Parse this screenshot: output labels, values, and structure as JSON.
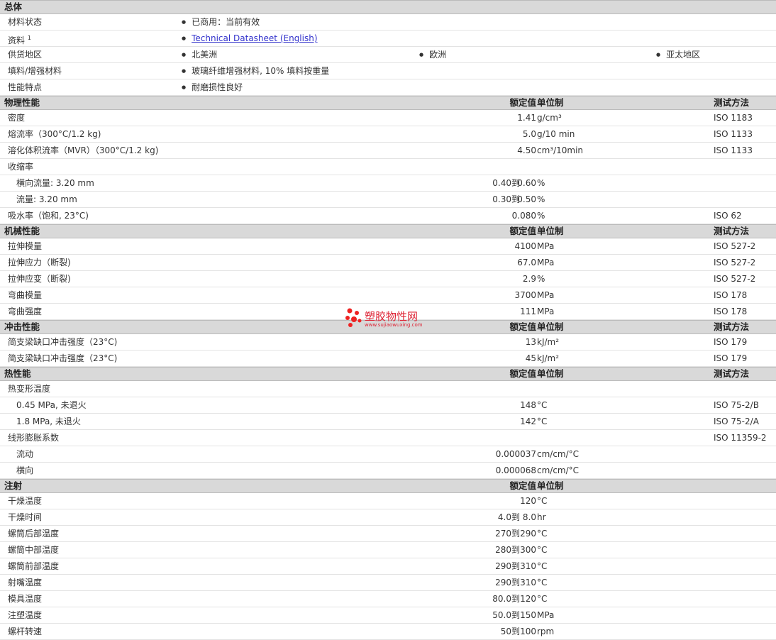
{
  "general": {
    "title": "总体",
    "rows": [
      {
        "label": "材料状态",
        "values": [
          "已商用：当前有效"
        ]
      },
      {
        "label": "资料",
        "sup": "1",
        "link": "Technical Datasheet (English)"
      },
      {
        "label": "供货地区",
        "values": [
          "北美洲",
          "欧洲",
          "亚太地区"
        ]
      },
      {
        "label": "填料/增强材料",
        "values": [
          "玻璃纤维增强材料, 10% 填料按重量"
        ]
      },
      {
        "label": "性能特点",
        "values": [
          "耐磨损性良好"
        ]
      }
    ]
  },
  "headers": {
    "nominal": "额定值",
    "unit": "单位制",
    "test": "测试方法",
    "to": "到"
  },
  "sections": [
    {
      "title": "物理性能",
      "has_test": true,
      "rows": [
        {
          "label": "密度",
          "value": "1.41",
          "unit": "g/cm³",
          "test": "ISO 1183"
        },
        {
          "label": "熔流率（300°C/1.2 kg)",
          "value": "5.0",
          "unit": "g/10 min",
          "test": "ISO 1133"
        },
        {
          "label": "溶化体积流率（MVR）（300°C/1.2 kg)",
          "value": "4.50",
          "unit": "cm³/10min",
          "test": "ISO 1133"
        },
        {
          "label": "收缩率"
        },
        {
          "label": "横向流量: 3.20 mm",
          "sub": true,
          "v1": "0.40",
          "v2": "0.60",
          "unit": "%"
        },
        {
          "label": "流量: 3.20 mm",
          "sub": true,
          "v1": "0.30",
          "v2": "0.50",
          "unit": "%"
        },
        {
          "label": "吸水率（饱和, 23°C)",
          "value": "0.080",
          "unit": "%",
          "test": "ISO 62"
        }
      ]
    },
    {
      "title": "机械性能",
      "has_test": true,
      "rows": [
        {
          "label": "拉伸模量",
          "value": "4100",
          "unit": "MPa",
          "test": "ISO 527-2"
        },
        {
          "label": "拉伸应力（断裂)",
          "value": "67.0",
          "unit": "MPa",
          "test": "ISO 527-2"
        },
        {
          "label": "拉伸应变（断裂)",
          "value": "2.9",
          "unit": "%",
          "test": "ISO 527-2"
        },
        {
          "label": "弯曲模量",
          "value": "3700",
          "unit": "MPa",
          "test": "ISO 178"
        },
        {
          "label": "弯曲强度",
          "value": "111",
          "unit": "MPa",
          "test": "ISO 178"
        }
      ]
    },
    {
      "title": "冲击性能",
      "has_test": true,
      "rows": [
        {
          "label": "简支梁缺口冲击强度（23°C)",
          "value": "13",
          "unit": "kJ/m²",
          "test": "ISO 179"
        },
        {
          "label": "简支梁缺口冲击强度（23°C)",
          "value": "45",
          "unit": "kJ/m²",
          "test": "ISO 179"
        }
      ]
    },
    {
      "title": "热性能",
      "has_test": true,
      "rows": [
        {
          "label": "热变形温度"
        },
        {
          "label": "0.45 MPa, 未退火",
          "sub": true,
          "value": "148",
          "unit": "°C",
          "test": "ISO 75-2/B"
        },
        {
          "label": "1.8 MPa, 未退火",
          "sub": true,
          "value": "142",
          "unit": "°C",
          "test": "ISO 75-2/A"
        },
        {
          "label": "线形膨胀系数",
          "test": "ISO 11359-2"
        },
        {
          "label": "流动",
          "sub": true,
          "value": "0.000037",
          "unit": "cm/cm/°C"
        },
        {
          "label": "横向",
          "sub": true,
          "value": "0.000068",
          "unit": "cm/cm/°C"
        }
      ]
    },
    {
      "title": "注射",
      "has_test": false,
      "rows": [
        {
          "label": "干燥温度",
          "value": "120",
          "unit": "°C"
        },
        {
          "label": "干燥时间",
          "v1": "4.0",
          "v2": "8.0",
          "unit": "hr"
        },
        {
          "label": "螺筒后部温度",
          "v1": "270",
          "v2": "290",
          "unit": "°C"
        },
        {
          "label": "螺筒中部温度",
          "v1": "280",
          "v2": "300",
          "unit": "°C"
        },
        {
          "label": "螺筒前部温度",
          "v1": "290",
          "v2": "310",
          "unit": "°C"
        },
        {
          "label": "射嘴温度",
          "v1": "290",
          "v2": "310",
          "unit": "°C"
        },
        {
          "label": "模具温度",
          "v1": "80.0",
          "v2": "120",
          "unit": "°C"
        },
        {
          "label": "注塑温度",
          "v1": "50.0",
          "v2": "150",
          "unit": "MPa"
        },
        {
          "label": "螺杆转速",
          "v1": "50",
          "v2": "100",
          "unit": "rpm"
        }
      ]
    }
  ],
  "watermark": {
    "title": "塑胶物性网",
    "url": "www.sujiaowuxing.com"
  }
}
